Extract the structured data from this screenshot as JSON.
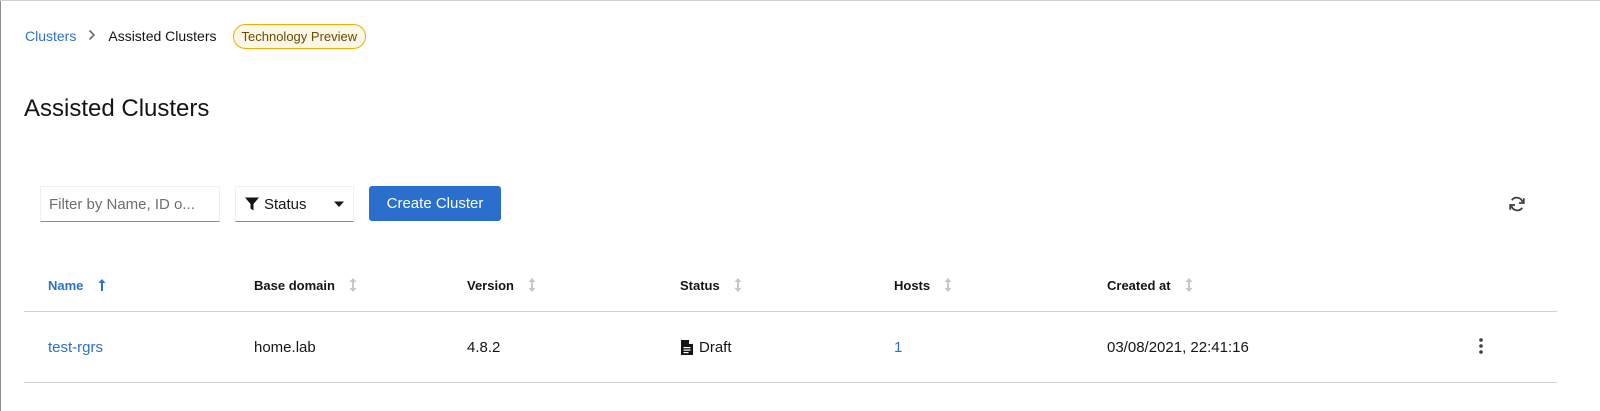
{
  "breadcrumb": {
    "parent_label": "Clusters",
    "current_label": "Assisted Clusters",
    "badge_label": "Technology Preview"
  },
  "page": {
    "title": "Assisted Clusters"
  },
  "toolbar": {
    "filter_placeholder": "Filter by Name, ID o...",
    "filter_value": "",
    "status_filter_label": "Status",
    "create_button_label": "Create Cluster",
    "refresh_icon": "refresh-icon"
  },
  "table": {
    "columns": [
      {
        "label": "Name",
        "sorted": "ascending"
      },
      {
        "label": "Base domain"
      },
      {
        "label": "Version"
      },
      {
        "label": "Status"
      },
      {
        "label": "Hosts"
      },
      {
        "label": "Created at"
      }
    ],
    "rows": [
      {
        "name": "test-rgrs",
        "base_domain": "home.lab",
        "version": "4.8.2",
        "status": "Draft",
        "status_icon": "document-icon",
        "hosts": "1",
        "created_at": "03/08/2021, 22:41:16"
      }
    ]
  },
  "colors": {
    "link": "#2b72c9",
    "primary_button": "#2b6fce",
    "badge_border": "#f0ab00",
    "badge_bg": "#fdf7e7"
  }
}
